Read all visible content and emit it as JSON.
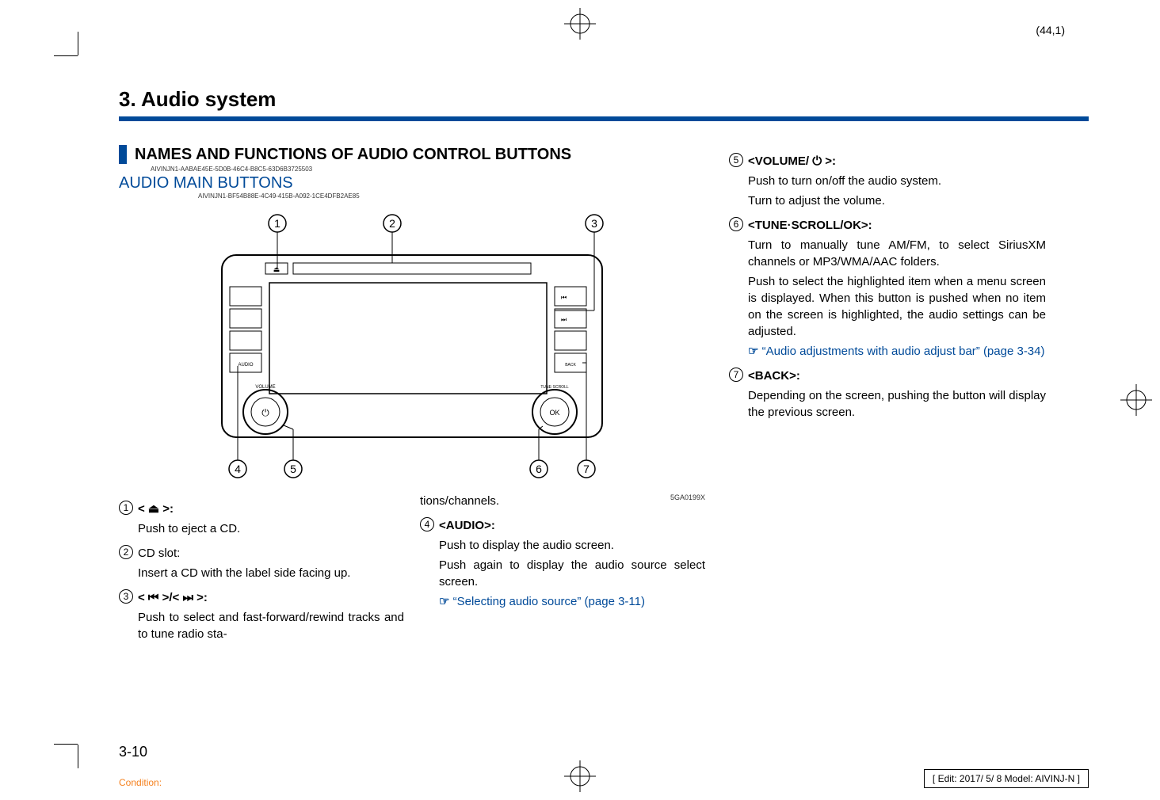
{
  "page_coord": "(44,1)",
  "chapter_title": "3. Audio system",
  "section_title": "NAMES AND FUNCTIONS OF AUDIO CONTROL BUTTONS",
  "section_id": "AIVINJN1-AABAE45E-5D0B-46C4-B8C5-63D6B3725503",
  "subsection_title": "AUDIO MAIN BUTTONS",
  "subsection_id": "AIVINJN1-BF54B88E-4C49-415B-A092-1CE4DFB2AE85",
  "image_ref": "5GA0199X",
  "items_left": [
    {
      "num": "1",
      "label": "< ⏏ >:",
      "body": "Push to eject a CD."
    },
    {
      "num": "2",
      "label": "CD slot:",
      "body": "Insert a CD with the label side facing up."
    },
    {
      "num": "3",
      "label": "< ⏮ >/< ⏭ >:",
      "body": "Push to select and fast-forward/rewind tracks and to tune radio sta-"
    }
  ],
  "mid_continuation": "tions/channels.",
  "items_mid": [
    {
      "num": "4",
      "label": "<AUDIO>:",
      "body1": "Push to display the audio screen.",
      "body2": "Push again to display the audio source select screen.",
      "link": "“Selecting audio source” (page 3-11)"
    }
  ],
  "items_right": [
    {
      "num": "5",
      "label": "<VOLUME/ ⏻ >:",
      "body1": "Push to turn on/off the audio system.",
      "body2": "Turn to adjust the volume."
    },
    {
      "num": "6",
      "label": "<TUNE·SCROLL/OK>:",
      "body1": "Turn to manually tune AM/FM, to select SiriusXM channels or MP3/WMA/AAC folders.",
      "body2": "Push to select the highlighted item when a menu screen is displayed. When this button is pushed when no item on the screen is highlighted, the audio settings can be adjusted.",
      "link": "“Audio adjustments with audio adjust bar” (page 3-34)"
    },
    {
      "num": "7",
      "label": "<BACK>:",
      "body1": "Depending on the screen, pushing the button will display the previous screen."
    }
  ],
  "page_number": "3-10",
  "condition_label": "Condition:",
  "edit_info": "[ Edit: 2017/ 5/ 8   Model:  AIVINJ-N ]",
  "diagram_labels": {
    "audio": "AUDIO",
    "volume": "VOLUME",
    "tune": "TUNE·SCROLL",
    "ok": "OK",
    "back": "BACK",
    "power": "⏻",
    "eject_btn": "⏏"
  },
  "callouts": [
    "1",
    "2",
    "3",
    "4",
    "5",
    "6",
    "7"
  ]
}
